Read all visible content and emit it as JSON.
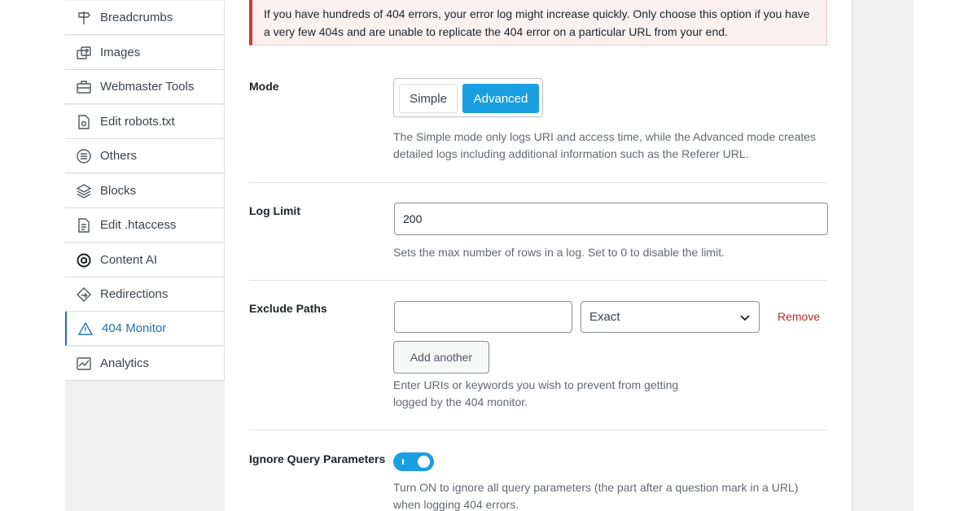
{
  "sidebar": {
    "items": [
      {
        "label": "Breadcrumbs",
        "icon": "signpost-icon"
      },
      {
        "label": "Images",
        "icon": "images-icon"
      },
      {
        "label": "Webmaster Tools",
        "icon": "toolbox-icon"
      },
      {
        "label": "Edit robots.txt",
        "icon": "file-icon"
      },
      {
        "label": "Others",
        "icon": "list-circle-icon"
      },
      {
        "label": "Blocks",
        "icon": "blocks-icon"
      },
      {
        "label": "Edit .htaccess",
        "icon": "document-icon"
      },
      {
        "label": "Content AI",
        "icon": "content-ai-icon"
      },
      {
        "label": "Redirections",
        "icon": "redirect-icon"
      },
      {
        "label": "404 Monitor",
        "icon": "warning-icon",
        "active": true
      },
      {
        "label": "Analytics",
        "icon": "analytics-icon"
      }
    ]
  },
  "notice": {
    "text": "If you have hundreds of 404 errors, your error log might increase quickly. Only choose this option if you have a very few 404s and are unable to replicate the 404 error on a particular URL from your end."
  },
  "mode": {
    "label": "Mode",
    "options": [
      "Simple",
      "Advanced"
    ],
    "selected": "Advanced",
    "description": "The Simple mode only logs URI and access time, while the Advanced mode creates detailed logs including additional information such as the Referer URL."
  },
  "log_limit": {
    "label": "Log Limit",
    "value": "200",
    "description": "Sets the max number of rows in a log. Set to 0 to disable the limit."
  },
  "exclude_paths": {
    "label": "Exclude Paths",
    "path_value": "",
    "match_type": "Exact",
    "remove_label": "Remove",
    "add_label": "Add another",
    "description_line1": "Enter URIs or keywords you wish to prevent from getting",
    "description_line2": "logged by the 404 monitor."
  },
  "ignore_query": {
    "label": "Ignore Query Parameters",
    "enabled": true,
    "description_line1": "Turn ON to ignore all query parameters (the part after a question mark in a URL)",
    "description_line2": "when logging 404 errors."
  },
  "colors": {
    "accent": "#1a9fe0",
    "active_link": "#2271b1",
    "danger": "#b32d2e",
    "notice_bg": "#fcf0f1"
  }
}
